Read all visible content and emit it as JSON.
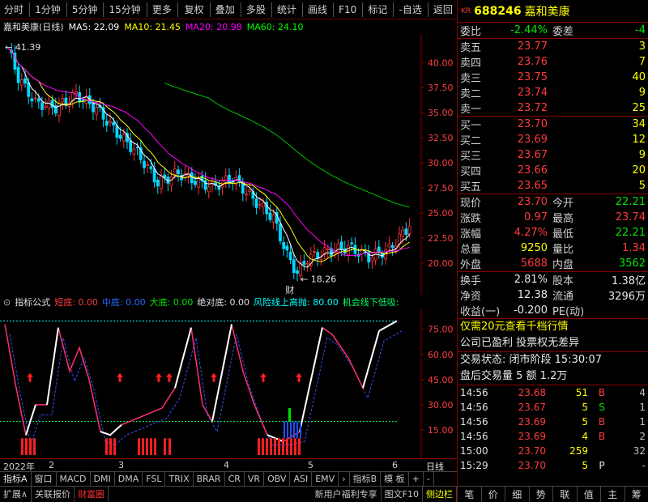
{
  "toolbar": {
    "items": [
      "分时",
      "1分钟",
      "5分钟",
      "15分钟",
      "更多",
      "复权",
      "叠加",
      "多股",
      "统计",
      "画线",
      "F10",
      "标记",
      "-自选",
      "返回"
    ]
  },
  "chart": {
    "name": "嘉和美康(日线)",
    "ma5": "MA5: 22.09",
    "ma10": "MA10: 21.45",
    "ma20": "MA20: 20.98",
    "ma60": "MA60: 24.10",
    "high_label": "41.39",
    "low_label": "18.26",
    "cai_badge": "财",
    "y_labels": [
      "40.00",
      "37.50",
      "35.00",
      "32.50",
      "30.00",
      "27.50",
      "25.00",
      "22.50",
      "20.00"
    ]
  },
  "indicator": {
    "title": "指标公式",
    "dd": "短底: 0.00",
    "zd": "中底: 0.00",
    "dad": "大底: 0.00",
    "jdd": "绝对底: 0.00",
    "fx": "风险线上高抛: 80.00",
    "jh": "机会线下低吸:",
    "y_labels": [
      "75.00",
      "60.00",
      "45.00",
      "30.00",
      "15.00"
    ]
  },
  "xaxis": {
    "labels": [
      "2022年",
      "2",
      "3",
      "4",
      "5",
      "6"
    ],
    "period": "日线"
  },
  "tabs": [
    "指标A",
    "窗口",
    "MACD",
    "DMI",
    "DMA",
    "FSL",
    "TRIX",
    "BRAR",
    "CR",
    "VR",
    "OBV",
    "ASI",
    "EMV",
    "指标B",
    "模 板",
    "+",
    "-"
  ],
  "bottom": {
    "items": [
      "扩展∧",
      "关联报价",
      "财富圈"
    ],
    "right_items": [
      "新用户福利专享",
      "图文F10",
      "侧边栏"
    ]
  },
  "stock": {
    "kr": "KR",
    "code": "688246",
    "name": "嘉和美康"
  },
  "quote": {
    "wb_label": "委比",
    "wb_value": "-2.44%",
    "wc_label": "委差",
    "wc_value": "-4",
    "asks": [
      {
        "label": "卖五",
        "price": "23.77",
        "vol": "3"
      },
      {
        "label": "卖四",
        "price": "23.76",
        "vol": "7"
      },
      {
        "label": "卖三",
        "price": "23.75",
        "vol": "40"
      },
      {
        "label": "卖二",
        "price": "23.74",
        "vol": "9"
      },
      {
        "label": "卖一",
        "price": "23.72",
        "vol": "25"
      }
    ],
    "bids": [
      {
        "label": "买一",
        "price": "23.70",
        "vol": "34"
      },
      {
        "label": "买二",
        "price": "23.69",
        "vol": "12"
      },
      {
        "label": "买三",
        "price": "23.67",
        "vol": "9"
      },
      {
        "label": "买四",
        "price": "23.66",
        "vol": "20"
      },
      {
        "label": "买五",
        "price": "23.65",
        "vol": "5"
      }
    ],
    "stats": [
      {
        "l1": "现价",
        "v1": "23.70",
        "c1": "red",
        "l2": "今开",
        "v2": "22.21",
        "c2": "green"
      },
      {
        "l1": "涨跌",
        "v1": "0.97",
        "c1": "red",
        "l2": "最高",
        "v2": "23.74",
        "c2": "red"
      },
      {
        "l1": "涨幅",
        "v1": "4.27%",
        "c1": "red",
        "l2": "最低",
        "v2": "22.21",
        "c2": "green"
      },
      {
        "l1": "总量",
        "v1": "9250",
        "c1": "yellow",
        "l2": "量比",
        "v2": "1.34",
        "c2": "red"
      },
      {
        "l1": "外盘",
        "v1": "5688",
        "c1": "red",
        "l2": "内盘",
        "v2": "3562",
        "c2": "green"
      }
    ],
    "stats2": [
      {
        "l1": "换手",
        "v1": "2.81%",
        "c1": "white",
        "l2": "股本",
        "v2": "1.38亿",
        "c2": "white"
      },
      {
        "l1": "净资",
        "v1": "12.38",
        "c1": "white",
        "l2": "流通",
        "v2": "3296万",
        "c2": "white"
      },
      {
        "l1": "收益(一)",
        "v1": "-0.200",
        "c1": "white",
        "l2": "PE(动)",
        "v2": "",
        "c2": "white"
      }
    ],
    "promo": "仅需20元查看千档行情",
    "profit": "公司已盈利 投票权无差异",
    "trade_state": "交易状态: 闭市阶段 15:30:07",
    "after_hours": "盘后交易量 5 额 1.2万",
    "ticks": [
      {
        "time": "14:56",
        "price": "23.68",
        "vol": "51",
        "side": "B",
        "sc": "red",
        "cnt": "4"
      },
      {
        "time": "14:56",
        "price": "23.67",
        "vol": "5",
        "side": "S",
        "sc": "green",
        "cnt": "1"
      },
      {
        "time": "14:56",
        "price": "23.69",
        "vol": "5",
        "side": "B",
        "sc": "red",
        "cnt": "1"
      },
      {
        "time": "14:56",
        "price": "23.69",
        "vol": "4",
        "side": "B",
        "sc": "red",
        "cnt": "2"
      },
      {
        "time": "15:00",
        "price": "23.70",
        "vol": "259",
        "side": "",
        "sc": "white",
        "cnt": "32"
      },
      {
        "time": "15:29",
        "price": "23.70",
        "vol": "5",
        "side": "P",
        "sc": "white",
        "cnt": "-"
      }
    ],
    "tabs": [
      "笔",
      "价",
      "细",
      "势",
      "联",
      "值",
      "主",
      "筹"
    ]
  }
}
